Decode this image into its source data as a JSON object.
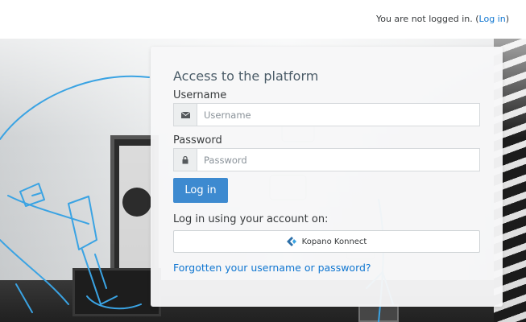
{
  "header": {
    "status_text": "You are not logged in.",
    "open_paren": " (",
    "login_link": "Log in",
    "close_paren": ")"
  },
  "login": {
    "title": "Access to the platform",
    "username_label": "Username",
    "username_placeholder": "Username",
    "password_label": "Password",
    "password_placeholder": "Password",
    "submit_label": "Log in",
    "alt_login_label": "Log in using your account on:",
    "idp_button_label": "Kopano Konnect",
    "forgot_link": "Forgotten your username or password?"
  },
  "icons": {
    "username_addon": "envelope-icon",
    "password_addon": "lock-icon",
    "idp_logo": "kopano-logo-icon"
  },
  "colors": {
    "accent": "#3d8ad0",
    "link": "#1177d1",
    "title": "#4b5c68",
    "card_bg": "#f7f7f8",
    "illustration": "#3aa3e3"
  }
}
